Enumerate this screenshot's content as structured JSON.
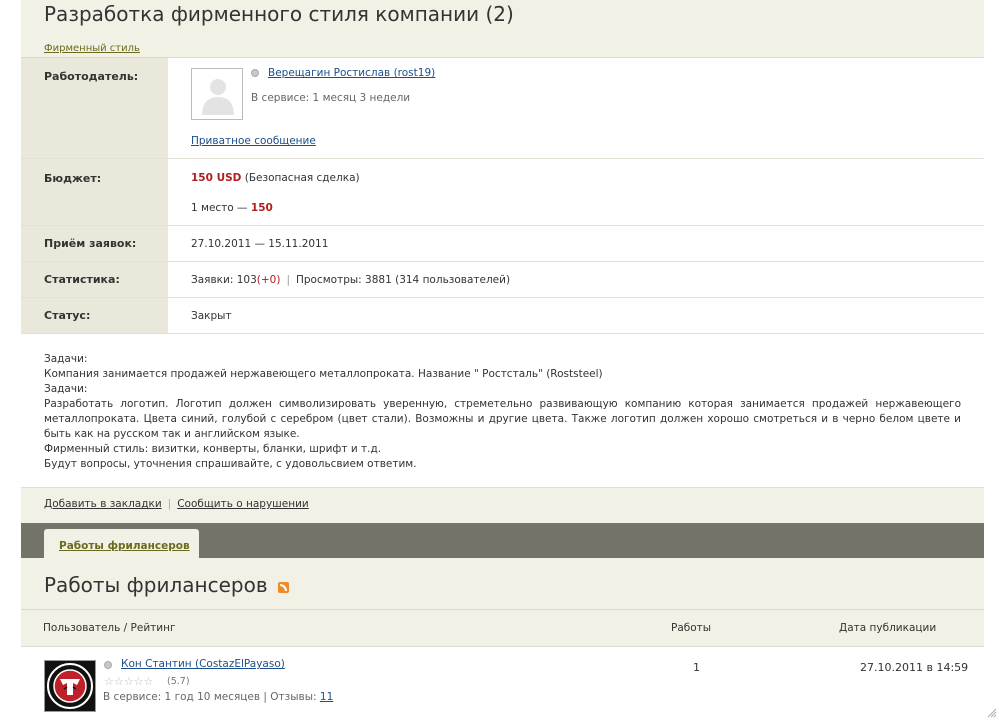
{
  "header": {
    "title": "Разработка фирменного стиля компании (2)",
    "category": "Фирменный стиль"
  },
  "employer": {
    "label": "Работодатель:",
    "name": "Верещагин Ростислав (rost19)",
    "service": "В сервисе: 1 месяц 3 недели",
    "message_link": "Приватное сообщение"
  },
  "budget": {
    "label": "Бюджет:",
    "amount": "150 USD",
    "note": "(Безопасная сделка)",
    "place_text": "1 место — ",
    "place_value": "150"
  },
  "applications": {
    "label": "Приём заявок:",
    "value": "27.10.2011 — 15.11.2011"
  },
  "stats": {
    "label": "Статистика:",
    "bids_text": "Заявки: 103 ",
    "bids_delta": "(+0)",
    "separator": "|",
    "views_text": "Просмотры: 3881 (314 пользователей)"
  },
  "status": {
    "label": "Статус:",
    "value": "Закрыт"
  },
  "description": [
    "Задачи:",
    "Компания занимается продажей нержавеющего металлопроката. Название \" Ростсталь\" (Roststeel)",
    "Задачи:",
    "Разработать логотип. Логотип должен символизировать уверенную, стреметельно развивающую компанию которая занимается продажей нержавеющего металлопроката. Цвета синий, голубой с серебром (цвет стали). Возможны и другие цвета. Также логотип должен хорошо смотреться и в черно белом цвете и быть как на русском так и английском языке.",
    "Фирменный стиль: визитки, конверты, бланки, шрифт и т.д.",
    "Будут вопросы, уточнения спрашивайте, с удовольсвием ответим."
  ],
  "actions": {
    "bookmark": "Добавить в закладки",
    "separator": "|",
    "report": "Сообщить о нарушении"
  },
  "tabs": [
    {
      "label": "Работы фрилансеров"
    }
  ],
  "section": {
    "title": "Работы фрилансеров",
    "rss_icon": "rss-icon"
  },
  "table": {
    "columns": [
      "Пользователь / Рейтинг",
      "Работы",
      "Дата публикации"
    ],
    "rows": [
      {
        "name": "Кон Стантин (CostazElPayaso)",
        "stars": "☆☆☆☆☆",
        "rating": "(5.7)",
        "service": "В сервисе: 1 год 10 месяцев | Отзывы: ",
        "reviews": "11",
        "works": "1",
        "date": "27.10.2011 в 14:59"
      }
    ]
  },
  "colors": {
    "panel_bg": "#f2f1e6",
    "label_bg": "#e9e8da",
    "tab_bar": "#737368",
    "link": "#1c4f8a",
    "accent_red": "#b21d1d"
  }
}
